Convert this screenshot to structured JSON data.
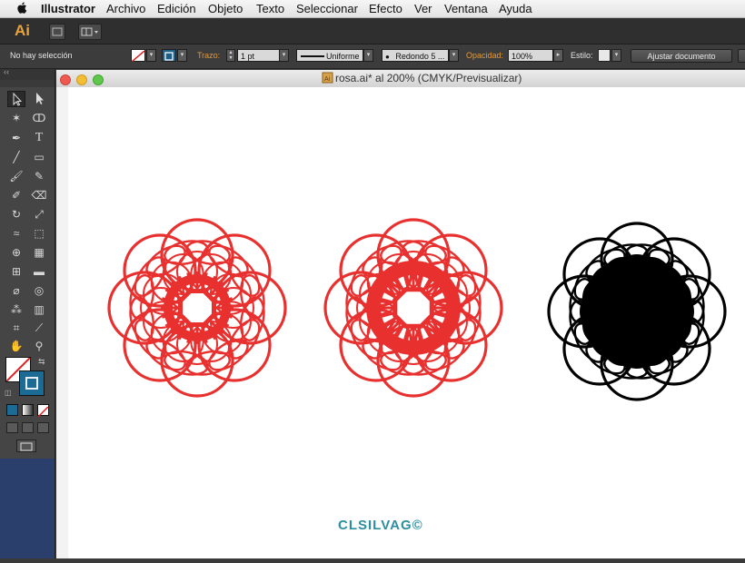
{
  "menubar": {
    "app_name": "Illustrator",
    "items": [
      "Archivo",
      "Edición",
      "Objeto",
      "Texto",
      "Seleccionar",
      "Efecto",
      "Ver",
      "Ventana",
      "Ayuda"
    ]
  },
  "appbar": {
    "logo": "Ai"
  },
  "control": {
    "selection_status": "No hay selección",
    "stroke_label": "Trazo:",
    "stroke_weight": "1 pt",
    "stroke_profile": "Uniforme",
    "brush": "Redondo 5 ...",
    "opacity_label": "Opacidad:",
    "opacity_value": "100%",
    "style_label": "Estilo:",
    "adjust_button": "Ajustar documento"
  },
  "document": {
    "title": "rosa.ai* al 200% (CMYK/Previsualizar)",
    "signature": "CLSILVAG©"
  },
  "artwork": {
    "colors": {
      "red": "#e8302f",
      "black": "#000000",
      "signature": "#2b8ea1"
    }
  },
  "colors": {
    "accent_orange": "#e79a36",
    "panel_dark": "#3c3c3c",
    "tools_bottom": "#2b3f6d"
  }
}
